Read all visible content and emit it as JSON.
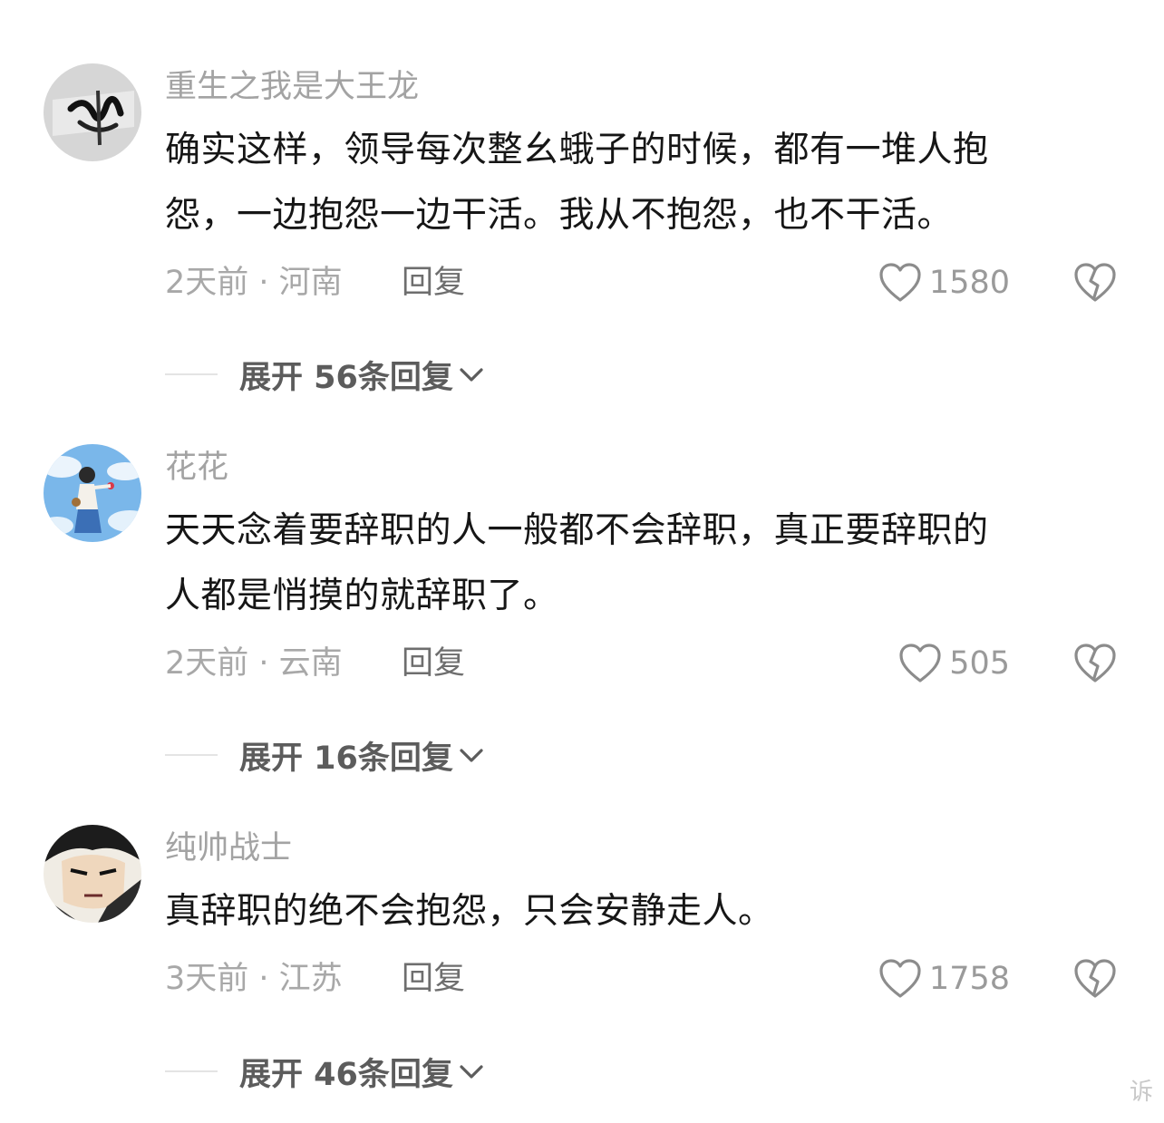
{
  "comments": [
    {
      "username": "重生之我是大王龙",
      "line1": "确实这样，领导每次整幺蛾子的时候，都有一堆人抱",
      "line2": "怨，一边抱怨一边干活。我从不抱怨，也不干活。",
      "meta": "2天前 · 河南",
      "reply": "回复",
      "likes": "1580",
      "expand": "展开 56条回复"
    },
    {
      "username": "花花",
      "line1": "天天念着要辞职的人一般都不会辞职，真正要辞职的",
      "line2": "人都是悄摸的就辞职了。",
      "meta": "2天前 · 云南",
      "reply": "回复",
      "likes": "505",
      "expand": "展开 16条回复"
    },
    {
      "username": "纯帅战士",
      "line1": "真辞职的绝不会抱怨，只会安静走人。",
      "line2": "",
      "meta": "3天前 · 江苏",
      "reply": "回复",
      "likes": "1758",
      "expand": "展开 46条回复"
    }
  ],
  "watermark": "诉",
  "icons": {
    "like": "heart-outline-icon",
    "dislike": "broken-heart-icon",
    "expand": "chevron-down-icon"
  }
}
